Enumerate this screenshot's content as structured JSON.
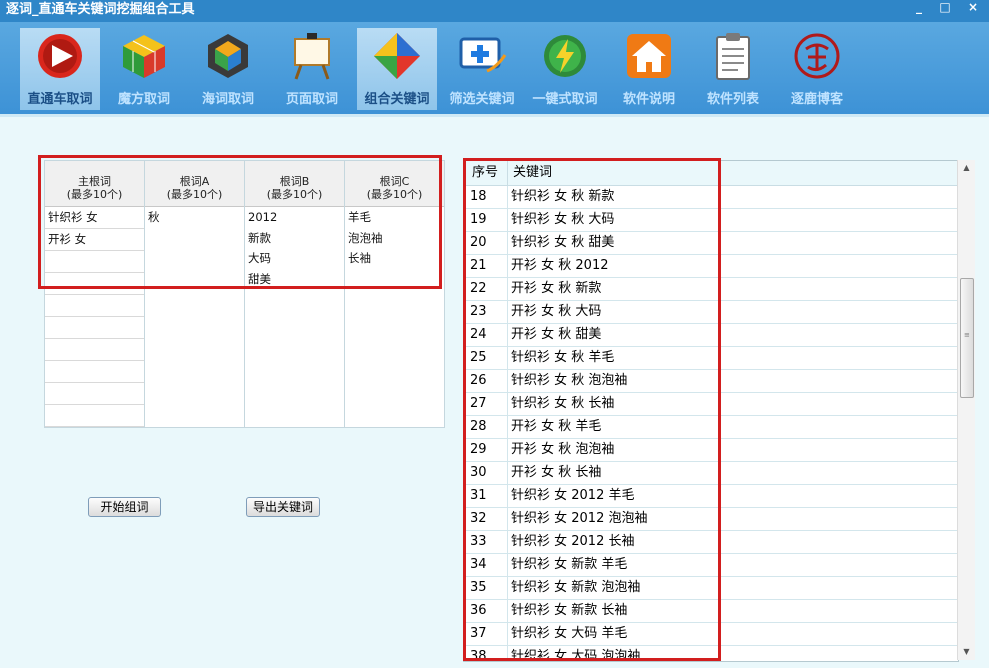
{
  "window": {
    "title": "逐词_直通车关键词挖掘组合工具",
    "btn_min": "_",
    "btn_max": "□",
    "btn_close": "×"
  },
  "toolbar": {
    "items": [
      {
        "label": "直通车取词",
        "icon": "ztc-play-icon",
        "active": true
      },
      {
        "label": "魔方取词",
        "icon": "cube-icon",
        "active": false
      },
      {
        "label": "海词取词",
        "icon": "hexagon-icon",
        "active": false
      },
      {
        "label": "页面取词",
        "icon": "easel-icon",
        "active": false
      },
      {
        "label": "组合关键词",
        "icon": "diamond-icon",
        "active": true
      },
      {
        "label": "筛选关键词",
        "icon": "filter-monitor-icon",
        "active": false
      },
      {
        "label": "一键式取词",
        "icon": "lightning-icon",
        "active": false
      },
      {
        "label": "软件说明",
        "icon": "home-icon",
        "active": false
      },
      {
        "label": "软件列表",
        "icon": "clipboard-icon",
        "active": false
      },
      {
        "label": "逐鹿博客",
        "icon": "seal-icon",
        "active": false
      }
    ]
  },
  "root_words": {
    "columns": [
      {
        "header": "主根词",
        "sub": "(最多10个)",
        "values": [
          "针织衫 女",
          "开衫 女"
        ]
      },
      {
        "header": "根词A",
        "sub": "(最多10个)",
        "values": [
          "秋"
        ]
      },
      {
        "header": "根词B",
        "sub": "(最多10个)",
        "values": [
          "2012",
          "新款",
          "大码",
          "甜美"
        ]
      },
      {
        "header": "根词C",
        "sub": "(最多10个)",
        "values": [
          "羊毛",
          "泡泡袖",
          "长袖"
        ]
      }
    ]
  },
  "buttons": {
    "start": "开始组词",
    "export": "导出关键词"
  },
  "results": {
    "headers": {
      "num": "序号",
      "keyword": "关键词"
    },
    "rows": [
      {
        "num": "18",
        "keyword": "针织衫 女 秋 新款"
      },
      {
        "num": "19",
        "keyword": "针织衫 女 秋 大码"
      },
      {
        "num": "20",
        "keyword": "针织衫 女 秋 甜美"
      },
      {
        "num": "21",
        "keyword": "开衫 女 秋 2012"
      },
      {
        "num": "22",
        "keyword": "开衫 女 秋 新款"
      },
      {
        "num": "23",
        "keyword": "开衫 女 秋 大码"
      },
      {
        "num": "24",
        "keyword": "开衫 女 秋 甜美"
      },
      {
        "num": "25",
        "keyword": "针织衫 女 秋 羊毛"
      },
      {
        "num": "26",
        "keyword": "针织衫 女 秋 泡泡袖"
      },
      {
        "num": "27",
        "keyword": "针织衫 女 秋 长袖"
      },
      {
        "num": "28",
        "keyword": "开衫 女 秋 羊毛"
      },
      {
        "num": "29",
        "keyword": "开衫 女 秋 泡泡袖"
      },
      {
        "num": "30",
        "keyword": "开衫 女 秋 长袖"
      },
      {
        "num": "31",
        "keyword": "针织衫 女 2012 羊毛"
      },
      {
        "num": "32",
        "keyword": "针织衫 女 2012 泡泡袖"
      },
      {
        "num": "33",
        "keyword": "针织衫 女 2012 长袖"
      },
      {
        "num": "34",
        "keyword": "针织衫 女 新款 羊毛"
      },
      {
        "num": "35",
        "keyword": "针织衫 女 新款 泡泡袖"
      },
      {
        "num": "36",
        "keyword": "针织衫 女 新款 长袖"
      },
      {
        "num": "37",
        "keyword": "针织衫 女 大码 羊毛"
      },
      {
        "num": "38",
        "keyword": "针织衫 女 大码 泡泡袖"
      }
    ]
  },
  "colors": {
    "highlight": "#d21e1e",
    "titlebar": "#2f86c8",
    "toolbar": "#4a9cdb",
    "background": "#eaf8fb"
  }
}
